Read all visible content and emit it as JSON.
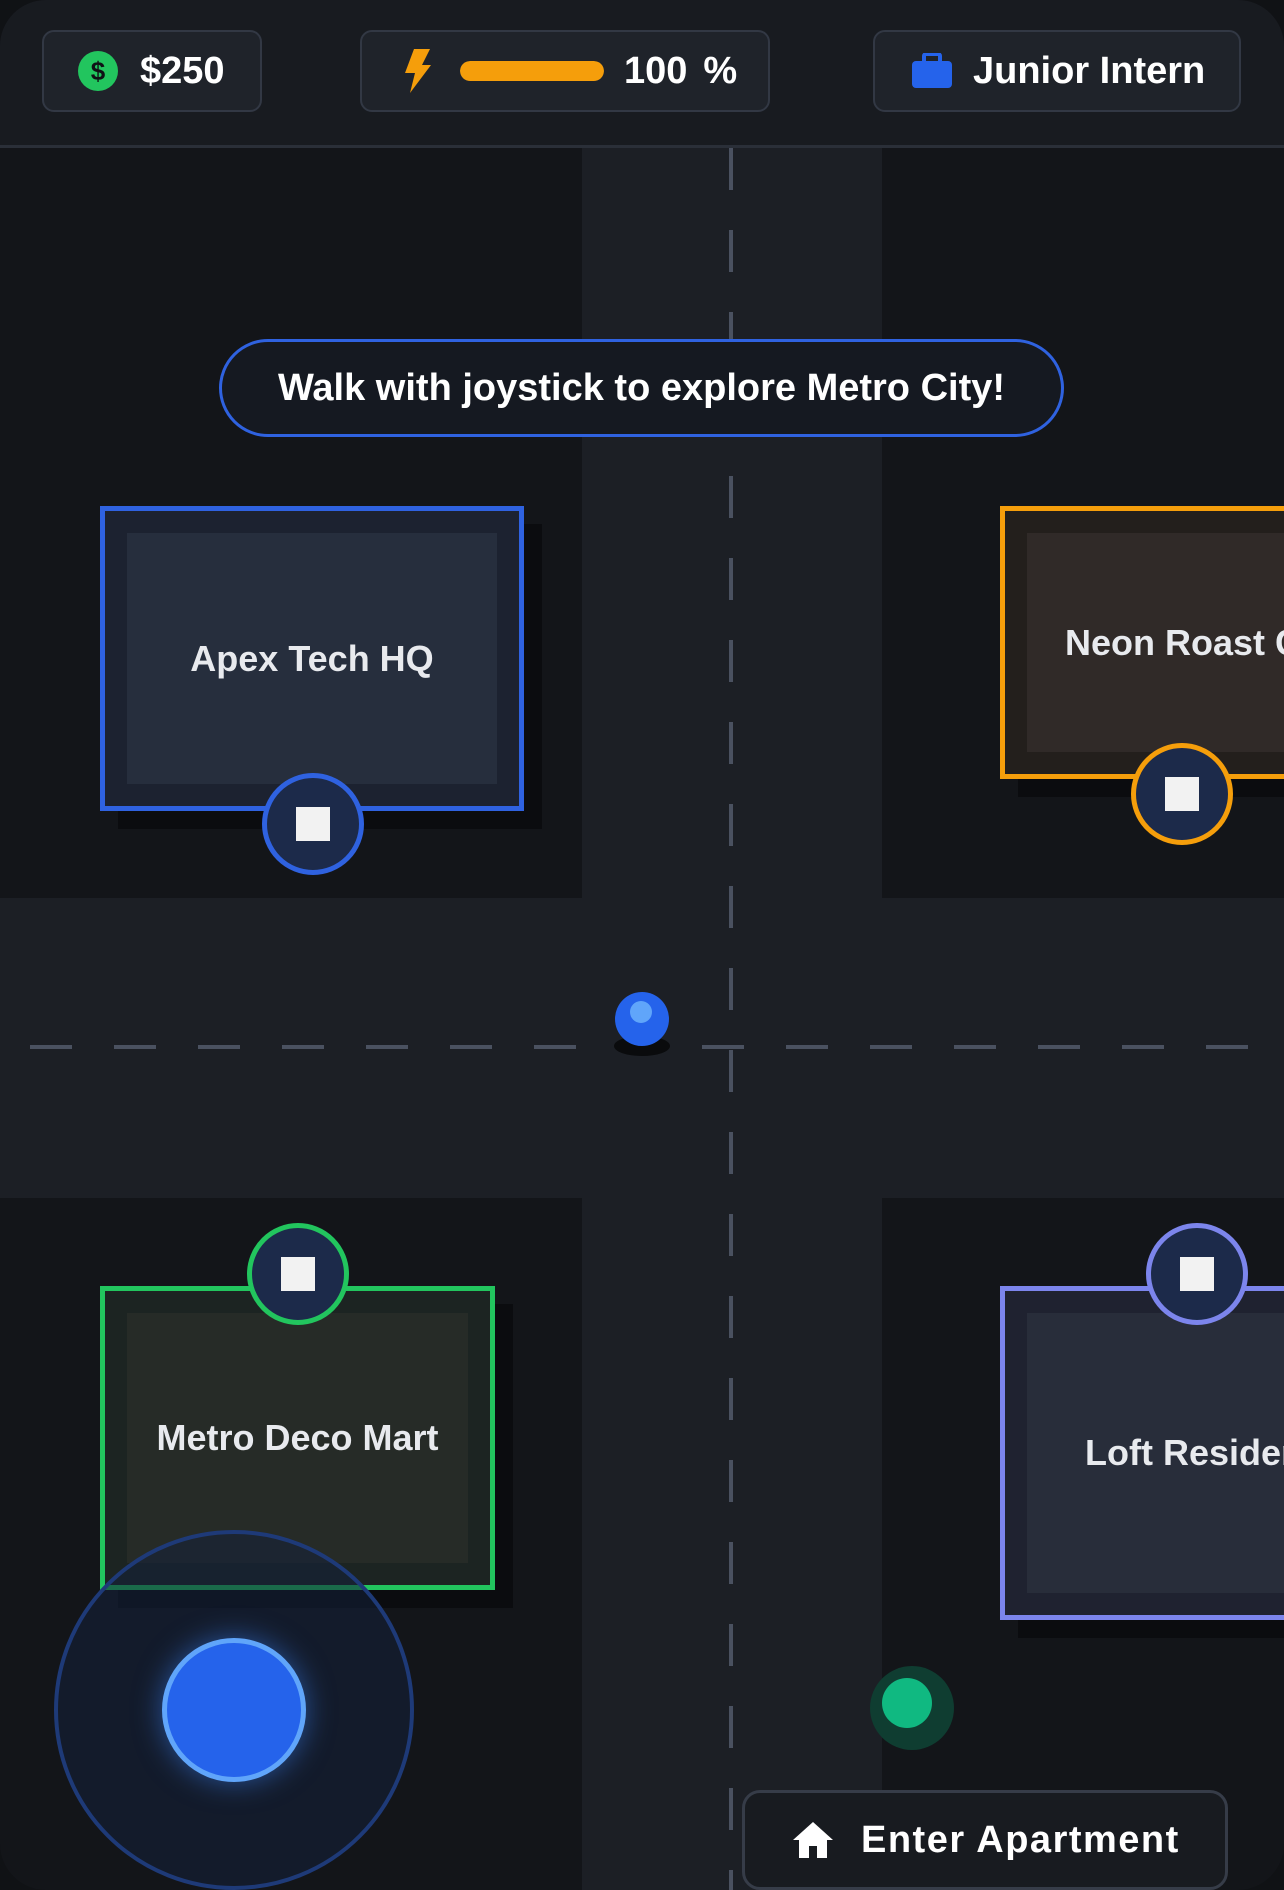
{
  "hud": {
    "money": "$250",
    "money_icon": "coin-icon",
    "energy_value": "100",
    "energy_unit": "%",
    "energy_fraction": 1.0,
    "energy_icon": "lightning-bolt-icon",
    "job_title": "Junior Intern",
    "job_icon": "briefcase-icon"
  },
  "tip": "Walk with joystick to explore Metro City!",
  "buildings": {
    "apex": {
      "name": "Apex Tech HQ",
      "color": "#2f62e0"
    },
    "neon": {
      "name": "Neon Roast Ca",
      "color": "#f59e0b"
    },
    "metro": {
      "name": "Metro Deco Mart",
      "color": "#22c55e"
    },
    "loft": {
      "name": "Loft Residenc",
      "color": "#7c85ec"
    }
  },
  "enter_button": {
    "label": "Enter Apartment",
    "icon": "home-icon"
  },
  "colors": {
    "accent": "#2563eb",
    "energy": "#f59e0b",
    "money": "#22c55e",
    "npc": "#10b981"
  }
}
